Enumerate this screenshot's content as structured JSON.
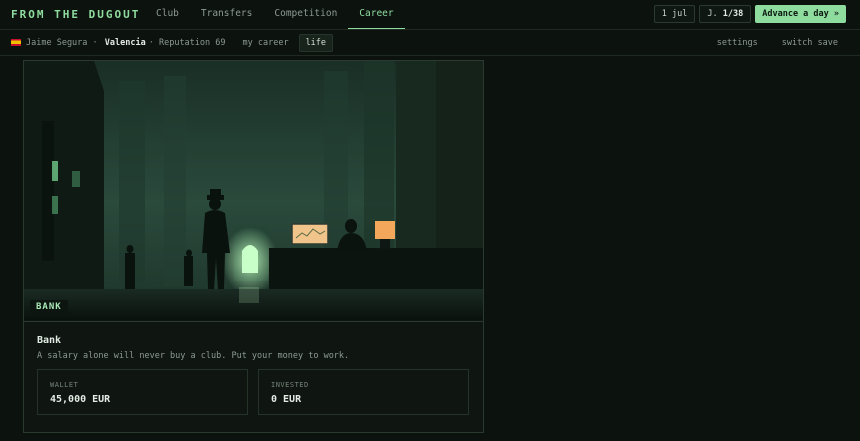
{
  "brand": "FROM THE DUGOUT",
  "nav": {
    "tabs": [
      "Club",
      "Transfers",
      "Competition",
      "Career"
    ],
    "active": "Career"
  },
  "topright": {
    "date": "1 jul",
    "matchday_prefix": "J.",
    "matchday": "1/38",
    "advance": "Advance a day »"
  },
  "subbar": {
    "manager": "Jaime Segura",
    "separator": " · ",
    "club": "Valencia",
    "reputation": "· Reputation 69",
    "links": [
      "my career",
      "life"
    ],
    "active_link": "life",
    "right": [
      "settings",
      "switch save"
    ]
  },
  "card": {
    "scene_label": "BANK",
    "title": "Bank",
    "subtitle": "A salary alone will never buy a club. Put your money to work.",
    "stats": [
      {
        "label": "WALLET",
        "value": "45,000 EUR"
      },
      {
        "label": "INVESTED",
        "value": "0 EUR"
      }
    ]
  },
  "colors": {
    "accent": "#8fdc9f",
    "background": "#0c120e",
    "lamp": "#f2a75b"
  },
  "icons": {
    "flag": "spain-flag-icon"
  }
}
